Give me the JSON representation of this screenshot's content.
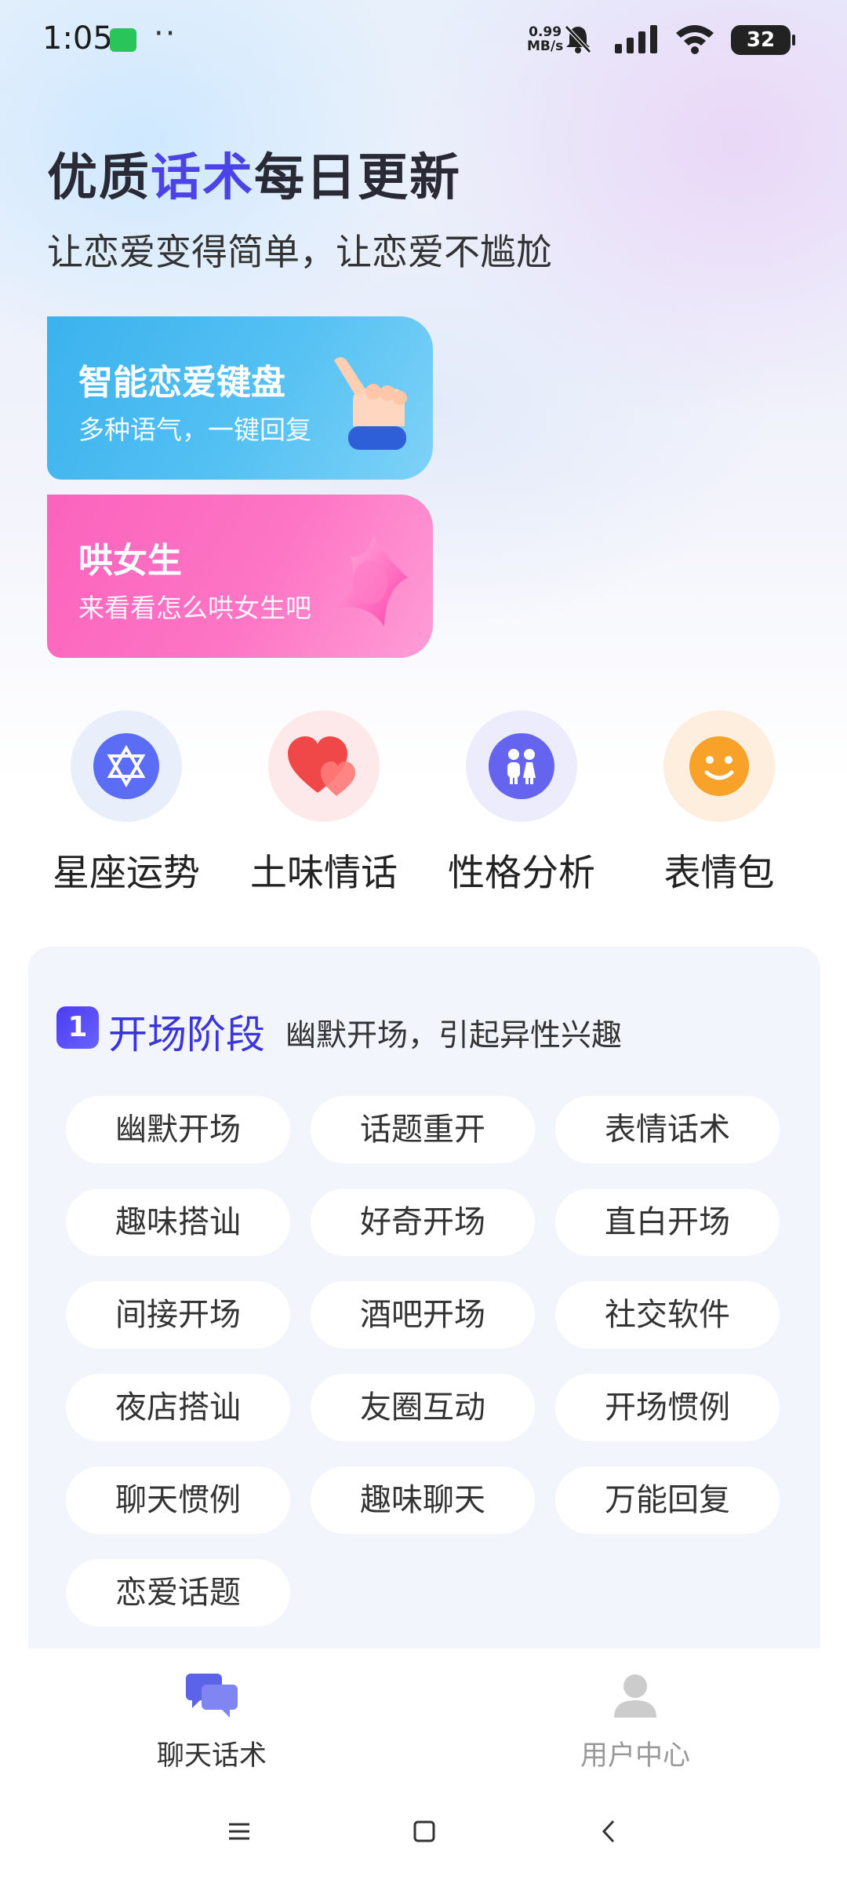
{
  "status_bar": {
    "time": "1:05",
    "net_speed_value": "0.99",
    "net_speed_unit": "MB/s",
    "battery": "32",
    "icons": [
      "notification-app-icon",
      "more-dots-icon",
      "mute-bell-icon",
      "signal-icon",
      "wifi-icon",
      "battery-icon"
    ]
  },
  "hero": {
    "title_part1": "优质",
    "title_highlight": "话术",
    "title_part2": "每日更新",
    "subtitle": "让恋爱变得简单，让恋爱不尴尬",
    "highlight_color": "#4b43e6"
  },
  "cards": [
    {
      "title": "智能恋爱键盘",
      "subtitle": "多种语气，一键回复",
      "icon": "pointing-hand-icon",
      "color": "#3bb2ee"
    },
    {
      "title": "哄女生",
      "subtitle": "来看看怎么哄女生吧",
      "icon": "pink-ribbon-icon",
      "color": "#fb63bd"
    }
  ],
  "quick_tools": [
    {
      "label": "星座运势",
      "icon": "star-of-david-icon",
      "color": "#5b6cf5"
    },
    {
      "label": "土味情话",
      "icon": "hearts-icon",
      "color": "#f04848"
    },
    {
      "label": "性格分析",
      "icon": "couple-icon",
      "color": "#6464ee"
    },
    {
      "label": "表情包",
      "icon": "smiley-icon",
      "color": "#f8a22a"
    }
  ],
  "stage": {
    "number": "1",
    "title": "开场阶段",
    "description": "幽默开场，引起异性兴趣",
    "tags": [
      "幽默开场",
      "话题重开",
      "表情话术",
      "趣味搭讪",
      "好奇开场",
      "直白开场",
      "间接开场",
      "酒吧开场",
      "社交软件",
      "夜店搭讪",
      "友圈互动",
      "开场惯例",
      "聊天惯例",
      "趣味聊天",
      "万能回复",
      "恋爱话题"
    ]
  },
  "bottom_nav": [
    {
      "label": "聊天话术",
      "icon": "chat-bubbles-icon",
      "active": true
    },
    {
      "label": "用户中心",
      "icon": "user-icon",
      "active": false
    }
  ],
  "colors": {
    "nav_active": "#333333",
    "nav_inactive": "#999999"
  }
}
